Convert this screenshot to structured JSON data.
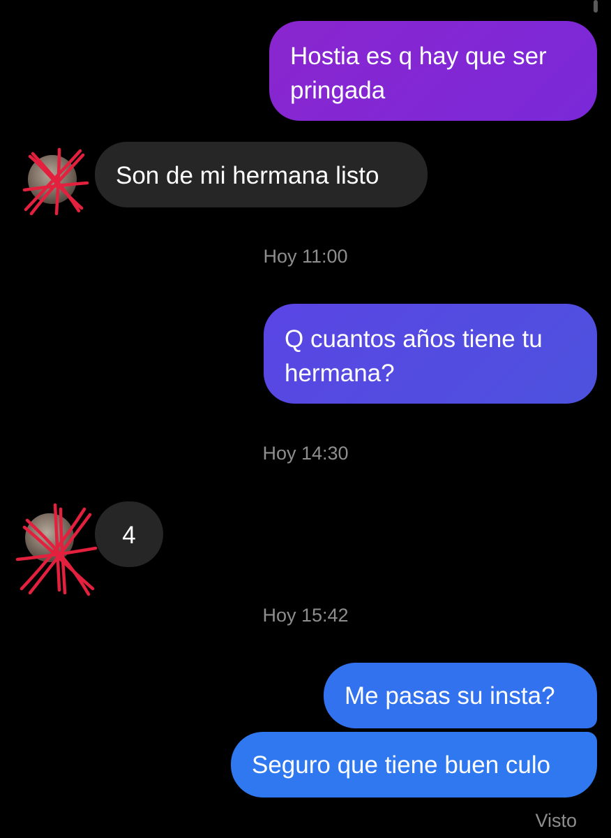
{
  "chat": {
    "messages": [
      {
        "direction": "outgoing",
        "text": "Hostia es q hay que ser pringada"
      },
      {
        "direction": "incoming",
        "text": "Son de mi hermana listo"
      },
      {
        "direction": "outgoing",
        "text": "Q cuantos años tiene tu hermana?"
      },
      {
        "direction": "incoming",
        "text": "4"
      },
      {
        "direction": "outgoing",
        "text": "Me pasas su insta?"
      },
      {
        "direction": "outgoing",
        "text": "Seguro que tiene buen culo"
      }
    ],
    "timestamps": [
      "Hoy 11:00",
      "Hoy 14:30",
      "Hoy 15:42"
    ],
    "seen_status": "Visto"
  },
  "avatar": {
    "icon": "scribbled-out-profile-photo",
    "scribble_color": "#e3203e"
  },
  "colors": {
    "background": "#000000",
    "incoming_bubble": "#262626",
    "outgoing_gradient_top": "#8a26cf",
    "outgoing_gradient_middle": "#5a45e4",
    "outgoing_gradient_bottom": "#3272ee",
    "meta_text": "#8e8e8e"
  }
}
